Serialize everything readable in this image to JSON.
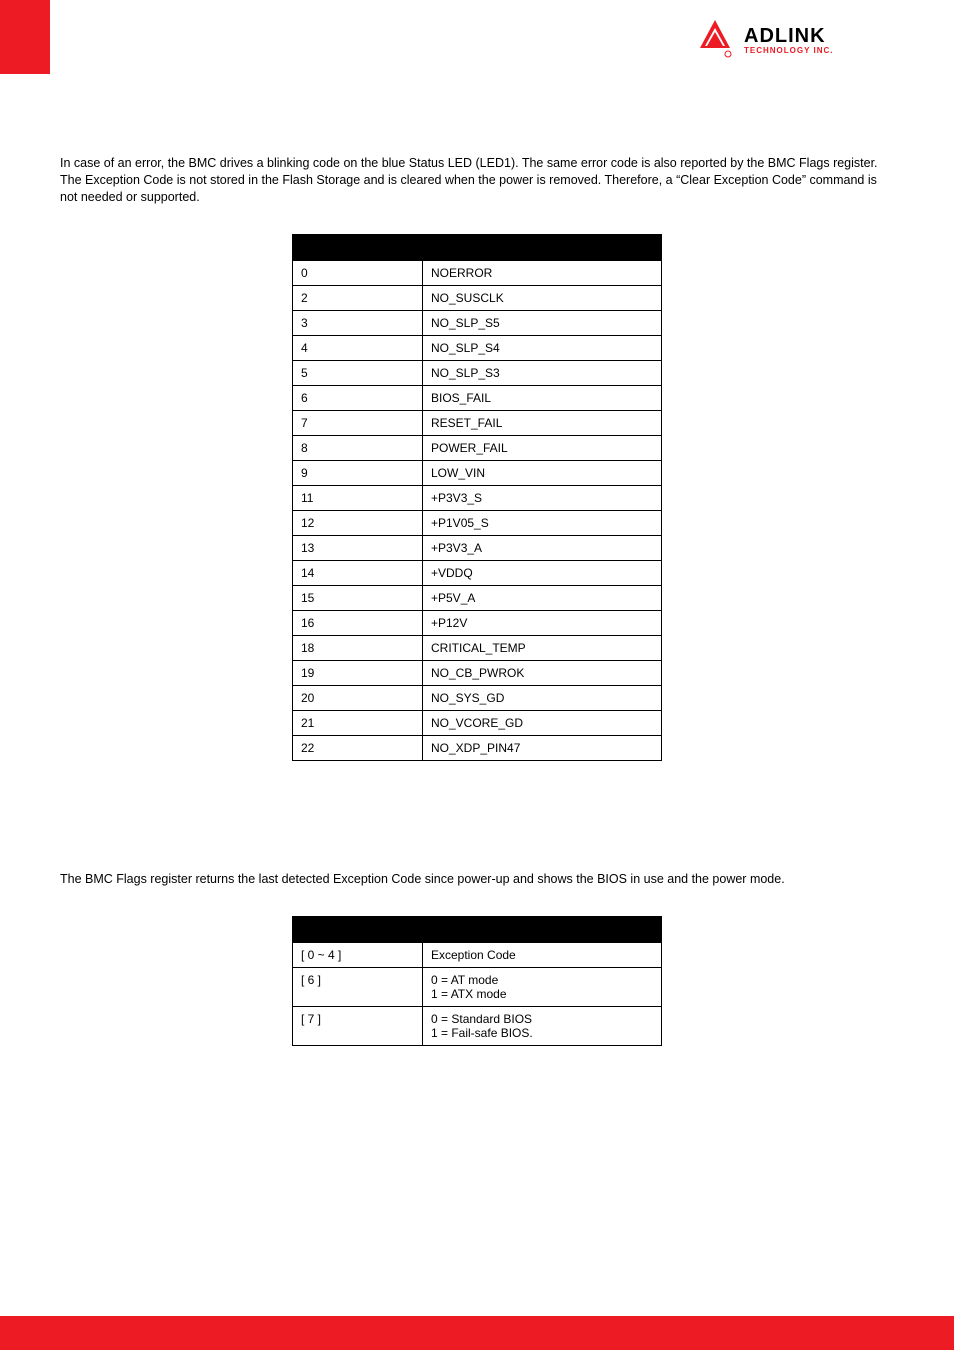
{
  "brand": {
    "name": "ADLINK",
    "sub": "TECHNOLOGY INC."
  },
  "para1": "In case of an error, the BMC drives a blinking code on the blue Status LED (LED1). The same error code is also reported by the BMC Flags register. The Exception Code is not stored in the Flash Storage and is cleared when the power is removed. Therefore, a “Clear Exception Code” command is not needed or supported.",
  "table1": {
    "rows": [
      {
        "c": "0",
        "n": "NOERROR"
      },
      {
        "c": "2",
        "n": "NO_SUSCLK"
      },
      {
        "c": "3",
        "n": "NO_SLP_S5"
      },
      {
        "c": "4",
        "n": "NO_SLP_S4"
      },
      {
        "c": "5",
        "n": "NO_SLP_S3"
      },
      {
        "c": "6",
        "n": "BIOS_FAIL"
      },
      {
        "c": "7",
        "n": "RESET_FAIL"
      },
      {
        "c": "8",
        "n": "POWER_FAIL"
      },
      {
        "c": "9",
        "n": "LOW_VIN"
      },
      {
        "c": "11",
        "n": "+P3V3_S"
      },
      {
        "c": "12",
        "n": "+P1V05_S"
      },
      {
        "c": "13",
        "n": "+P3V3_A"
      },
      {
        "c": "14",
        "n": "+VDDQ"
      },
      {
        "c": "15",
        "n": "+P5V_A"
      },
      {
        "c": "16",
        "n": "+P12V"
      },
      {
        "c": "18",
        "n": "CRITICAL_TEMP"
      },
      {
        "c": "19",
        "n": "NO_CB_PWROK"
      },
      {
        "c": "20",
        "n": "NO_SYS_GD"
      },
      {
        "c": "21",
        "n": "NO_VCORE_GD"
      },
      {
        "c": "22",
        "n": "NO_XDP_PIN47"
      }
    ]
  },
  "para2": "The BMC Flags register returns the last detected Exception Code since power-up and shows the BIOS in use and the power mode.",
  "table2": {
    "rows": [
      {
        "b": "[ 0 ~ 4 ]",
        "d": "Exception Code"
      },
      {
        "b": "[ 6 ]",
        "d": "0 = AT mode\n1 = ATX mode"
      },
      {
        "b": "[ 7 ]",
        "d": "0 = Standard BIOS\n1 = Fail-safe BIOS."
      }
    ]
  }
}
